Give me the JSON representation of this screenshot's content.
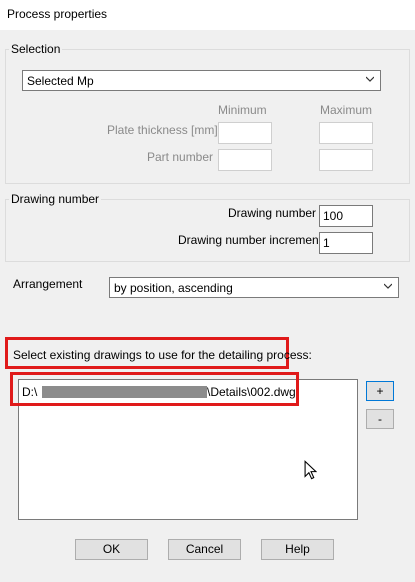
{
  "window": {
    "title": "Process properties"
  },
  "selection": {
    "legend": "Selection",
    "dropdown_value": "Selected Mp",
    "col_min": "Minimum",
    "col_max": "Maximum",
    "plate_thickness_label": "Plate thickness [mm]",
    "part_number_label": "Part number"
  },
  "drawing_number": {
    "legend": "Drawing number",
    "number_label": "Drawing number",
    "number_value": "100",
    "increment_label": "Drawing number increment",
    "increment_value": "1"
  },
  "arrangement": {
    "label": "Arrangement",
    "value": "by position, ascending"
  },
  "existing": {
    "label": "Select existing drawings to use for the detailing process:",
    "items": [
      {
        "prefix": "D:\\",
        "suffix": "\\Details\\002.dwg"
      }
    ],
    "add_label": "+",
    "remove_label": "-"
  },
  "buttons": {
    "ok": "OK",
    "cancel": "Cancel",
    "help": "Help"
  }
}
